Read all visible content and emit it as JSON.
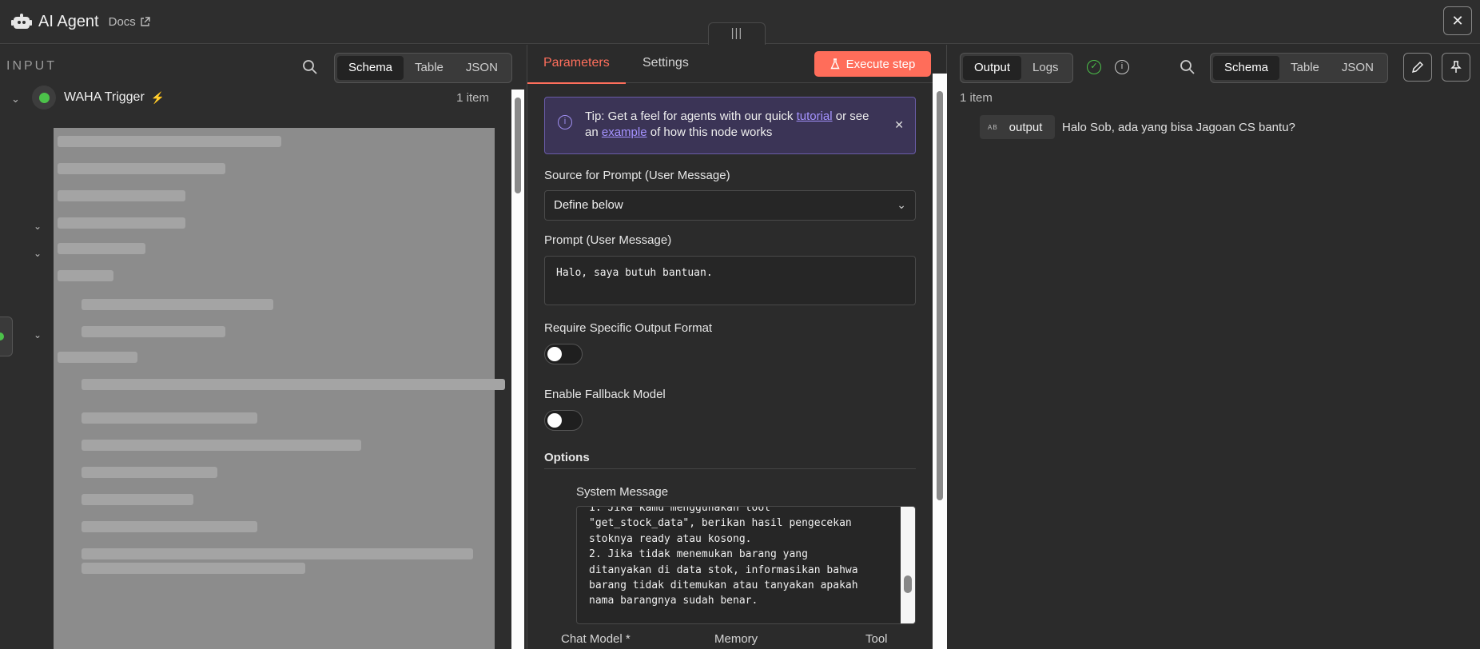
{
  "header": {
    "title": "AI Agent",
    "docs_label": "Docs"
  },
  "input": {
    "label": "INPUT",
    "views": [
      "Schema",
      "Table",
      "JSON"
    ],
    "active_view": "Schema",
    "trigger": {
      "name": "WAHA Trigger",
      "count": "1 item"
    }
  },
  "params": {
    "tabs": {
      "parameters": "Parameters",
      "settings": "Settings"
    },
    "execute_label": "Execute step",
    "tip": {
      "prefix": "Tip: Get a feel for agents with our quick",
      "tutorial": "tutorial",
      "mid": "or see an",
      "example": "example",
      "suffix": "of how this node works"
    },
    "source_label": "Source for Prompt (User Message)",
    "source_value": "Define below",
    "prompt_label": "Prompt (User Message)",
    "prompt_value": "Halo, saya butuh bantuan.",
    "require_label": "Require Specific Output Format",
    "require_enabled": false,
    "fallback_label": "Enable Fallback Model",
    "fallback_enabled": false,
    "options_label": "Options",
    "system_label": "System Message",
    "system_text": "1. Jika kamu menggunakan tool\n\"get_stock_data\", berikan hasil pengecekan\nstoknya ready atau kosong.\n2. Jika tidak menemukan barang yang\nditanyakan di data stok, informasikan bahwa\nbarang tidak ditemukan atau tanyakan apakah\nnama barangnya sudah benar.",
    "subnodes": [
      "Chat Model *",
      "Memory",
      "Tool"
    ]
  },
  "output": {
    "tabs": [
      "Output",
      "Logs"
    ],
    "active_tab": "Output",
    "views": [
      "Schema",
      "Table",
      "JSON"
    ],
    "active_view": "Schema",
    "count": "1 item",
    "key_type": "AB",
    "key": "output",
    "value": "Halo Sob, ada yang bisa Jagoan CS bantu?"
  },
  "colors": {
    "accent": "#ff6d5a",
    "success": "#4cc24a",
    "tip_border": "#6a5ca8"
  }
}
